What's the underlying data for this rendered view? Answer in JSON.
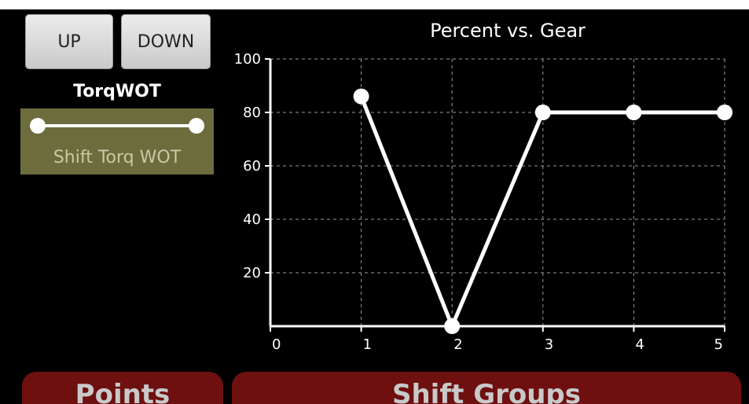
{
  "buttons": {
    "up_label": "UP",
    "down_label": "DOWN"
  },
  "parameter": {
    "title": "TorqWOT",
    "slider_label": "Shift Torq WOT"
  },
  "tabs": {
    "points_label": "Points",
    "shift_groups_label": "Shift Groups"
  },
  "colors": {
    "background": "#000000",
    "slider_panel": "#6c6c3c",
    "tab_red": "#6e1010",
    "line": "#ffffff"
  },
  "chart_data": {
    "type": "line",
    "title": "Percent vs. Gear",
    "xlabel": "",
    "ylabel": "",
    "xlim": [
      0,
      5
    ],
    "ylim": [
      0,
      100
    ],
    "x_ticks": [
      0,
      1,
      2,
      3,
      4,
      5
    ],
    "y_ticks": [
      20,
      40,
      60,
      80,
      100
    ],
    "grid": true,
    "grid_style": "dashed",
    "series": [
      {
        "x": [
          1,
          2,
          3,
          4,
          5
        ],
        "y": [
          86,
          0,
          80,
          80,
          80
        ]
      }
    ]
  }
}
